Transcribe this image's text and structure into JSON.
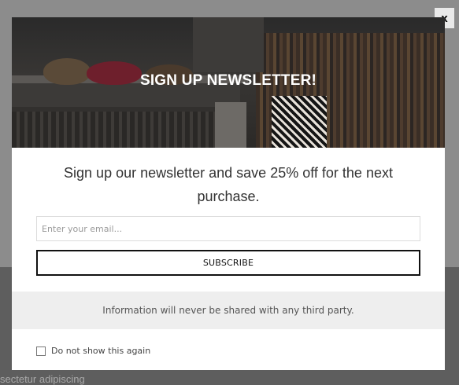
{
  "background": {
    "partial_text": "sectetur adipiscing"
  },
  "close": {
    "label": "x"
  },
  "modal": {
    "hero_title": "SIGN UP NEWSLETTER!",
    "lead": "Sign up our newsletter and save 25% off for the next purchase.",
    "email_placeholder": "Enter your email...",
    "subscribe_label": "SUBSCRIBE",
    "info_text": "Information will never be shared with any third party.",
    "dont_show_label": "Do not show this again"
  },
  "colors": {
    "overlay": "#8c8c8c",
    "hero_bg": "#2f2d2b",
    "info_band": "#eeeeee"
  }
}
